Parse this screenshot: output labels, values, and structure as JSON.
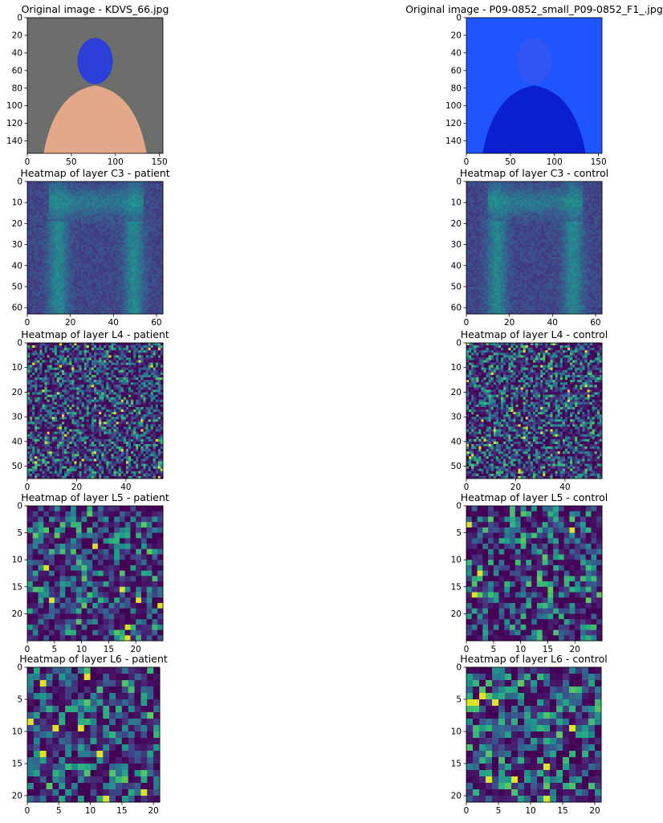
{
  "figure": {
    "panels": [
      {
        "id": "orig-patient",
        "title": "Original image - KDVS_66.jpg",
        "kind": "photo",
        "photo": {
          "bg": "#6b6e6a",
          "subject": "#e3a789",
          "face": "#2a3fd8"
        },
        "xticks": [
          "0",
          "50",
          "100",
          "150"
        ],
        "yticks": [
          "0",
          "20",
          "40",
          "60",
          "80",
          "100",
          "120",
          "140"
        ]
      },
      {
        "id": "orig-control",
        "title": "Original image - P09-0852_small_P09-0852_F1_.jpg",
        "kind": "photo",
        "photo": {
          "bg": "#1f55ff",
          "subject": "#0b1fd0",
          "face": "#2f56f2"
        },
        "xticks": [
          "0",
          "50",
          "100",
          "150"
        ],
        "yticks": [
          "0",
          "20",
          "40",
          "60",
          "80",
          "100",
          "120",
          "140"
        ]
      },
      {
        "id": "c3-patient",
        "title": "Heatmap of layer C3 - patient",
        "kind": "heatmap",
        "grid": 63,
        "seed": 11,
        "xticks": [
          "0",
          "20",
          "40",
          "60"
        ],
        "yticks": [
          "0",
          "10",
          "20",
          "30",
          "40",
          "50",
          "60"
        ]
      },
      {
        "id": "c3-control",
        "title": "Heatmap of layer C3 - control",
        "kind": "heatmap",
        "grid": 63,
        "seed": 23,
        "xticks": [
          "0",
          "20",
          "40",
          "60"
        ],
        "yticks": [
          "0",
          "10",
          "20",
          "30",
          "40",
          "50",
          "60"
        ]
      },
      {
        "id": "l4-patient",
        "title": "Heatmap of layer L4 - patient",
        "kind": "heatmap",
        "grid": 55,
        "seed": 37,
        "xticks": [
          "0",
          "20",
          "40"
        ],
        "yticks": [
          "0",
          "10",
          "20",
          "30",
          "40",
          "50"
        ]
      },
      {
        "id": "l4-control",
        "title": "Heatmap of layer L4 - control",
        "kind": "heatmap",
        "grid": 55,
        "seed": 41,
        "xticks": [
          "0",
          "20",
          "40"
        ],
        "yticks": [
          "0",
          "10",
          "20",
          "30",
          "40",
          "50"
        ]
      },
      {
        "id": "l5-patient",
        "title": "Heatmap of layer L5 - patient",
        "kind": "heatmap",
        "grid": 25,
        "seed": 53,
        "xticks": [
          "0",
          "5",
          "10",
          "15",
          "20"
        ],
        "yticks": [
          "0",
          "5",
          "10",
          "15",
          "20"
        ]
      },
      {
        "id": "l5-control",
        "title": "Heatmap of layer L5 - control",
        "kind": "heatmap",
        "grid": 25,
        "seed": 67,
        "xticks": [
          "0",
          "5",
          "10",
          "15",
          "20"
        ],
        "yticks": [
          "0",
          "5",
          "10",
          "15",
          "20"
        ]
      },
      {
        "id": "l6-patient",
        "title": "Heatmap of layer L6 - patient",
        "kind": "heatmap",
        "grid": 21,
        "seed": 79,
        "xticks": [
          "0",
          "5",
          "10",
          "15",
          "20"
        ],
        "yticks": [
          "0",
          "5",
          "10",
          "15",
          "20"
        ]
      },
      {
        "id": "l6-control",
        "title": "Heatmap of layer L6 - control",
        "kind": "heatmap",
        "grid": 21,
        "seed": 97,
        "xticks": [
          "0",
          "5",
          "10",
          "15",
          "20"
        ],
        "yticks": [
          "0",
          "5",
          "10",
          "15",
          "20"
        ]
      }
    ]
  }
}
